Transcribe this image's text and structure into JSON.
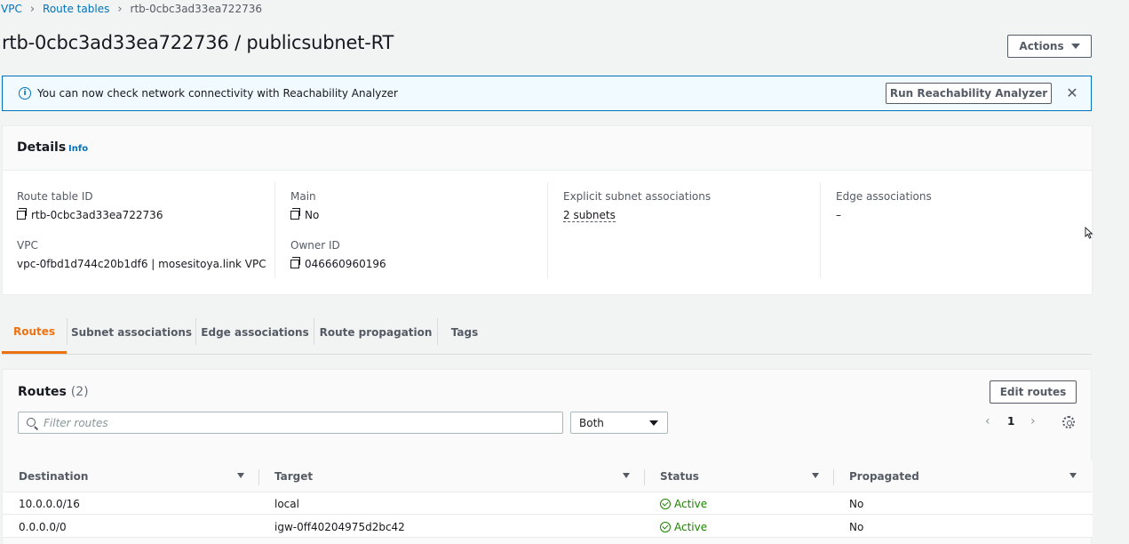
{
  "breadcrumb": {
    "items": [
      "VPC",
      "Route tables"
    ],
    "current": "rtb-0cbc3ad33ea722736"
  },
  "page_title": "rtb-0cbc3ad33ea722736 / publicsubnet-RT",
  "actions_label": "Actions",
  "flash": {
    "message": "You can now check network connectivity with Reachability Analyzer",
    "button_label": "Run Reachability Analyzer",
    "close_symbol": "✕"
  },
  "details": {
    "title": "Details",
    "info": "Info",
    "route_table_id_label": "Route table ID",
    "route_table_id": "rtb-0cbc3ad33ea722736",
    "vpc_label": "VPC",
    "vpc": "vpc-0fbd1d744c20b1df6 | mosesitoya.link VPC",
    "main_label": "Main",
    "main": "No",
    "owner_label": "Owner ID",
    "owner": "046660960196",
    "explicit_label": "Explicit subnet associations",
    "explicit": "2 subnets",
    "edge_label": "Edge associations",
    "edge": "–"
  },
  "tabs": [
    "Routes",
    "Subnet associations",
    "Edge associations",
    "Route propagation",
    "Tags"
  ],
  "routes": {
    "title": "Routes",
    "count": "(2)",
    "edit_label": "Edit routes",
    "filter_placeholder": "Filter routes",
    "select_value": "Both",
    "page": "1",
    "prev": "‹",
    "next": "›",
    "columns": [
      "Destination",
      "Target",
      "Status",
      "Propagated"
    ],
    "rows": [
      {
        "destination": "10.0.0.0/16",
        "target": "local",
        "status": "Active",
        "propagated": "No"
      },
      {
        "destination": "0.0.0.0/0",
        "target": "igw-0ff40204975d2bc42",
        "status": "Active",
        "propagated": "No"
      }
    ]
  },
  "colors": {
    "link": "#0073bb",
    "active_tab": "#ec7211",
    "success": "#1d8102"
  }
}
